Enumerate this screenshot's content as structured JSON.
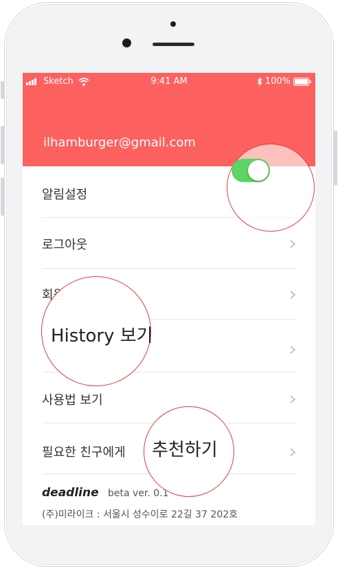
{
  "status_bar": {
    "carrier": "Sketch",
    "time": "9:41 AM",
    "battery": "100%"
  },
  "header": {
    "email": "ilhamburger@gmail.com",
    "background_color": "#fc6160"
  },
  "menu": {
    "notifications_label": "알림설정",
    "notifications_on": true,
    "logout_label": "로그아웃",
    "member_partial_label": "회원",
    "history_zoom_label": "History 보기",
    "usage_label": "사용법 보기",
    "recommend_prefix": "필요한 친구에게",
    "recommend_zoom_label": "추천하기"
  },
  "footer": {
    "brand": "deadline",
    "version": "beta ver. 0.1",
    "address": "(주)미라이크 : 서울시 성수이로 22길 37  202호"
  },
  "colors": {
    "accent": "#fc6160",
    "toggle_on": "#5ed465",
    "highlight_circle": "#e03b37"
  },
  "icons": {
    "chevron": "chevron-right-icon",
    "wifi": "wifi-icon",
    "signal": "signal-icon",
    "bluetooth": "bluetooth-icon",
    "battery": "battery-icon"
  }
}
